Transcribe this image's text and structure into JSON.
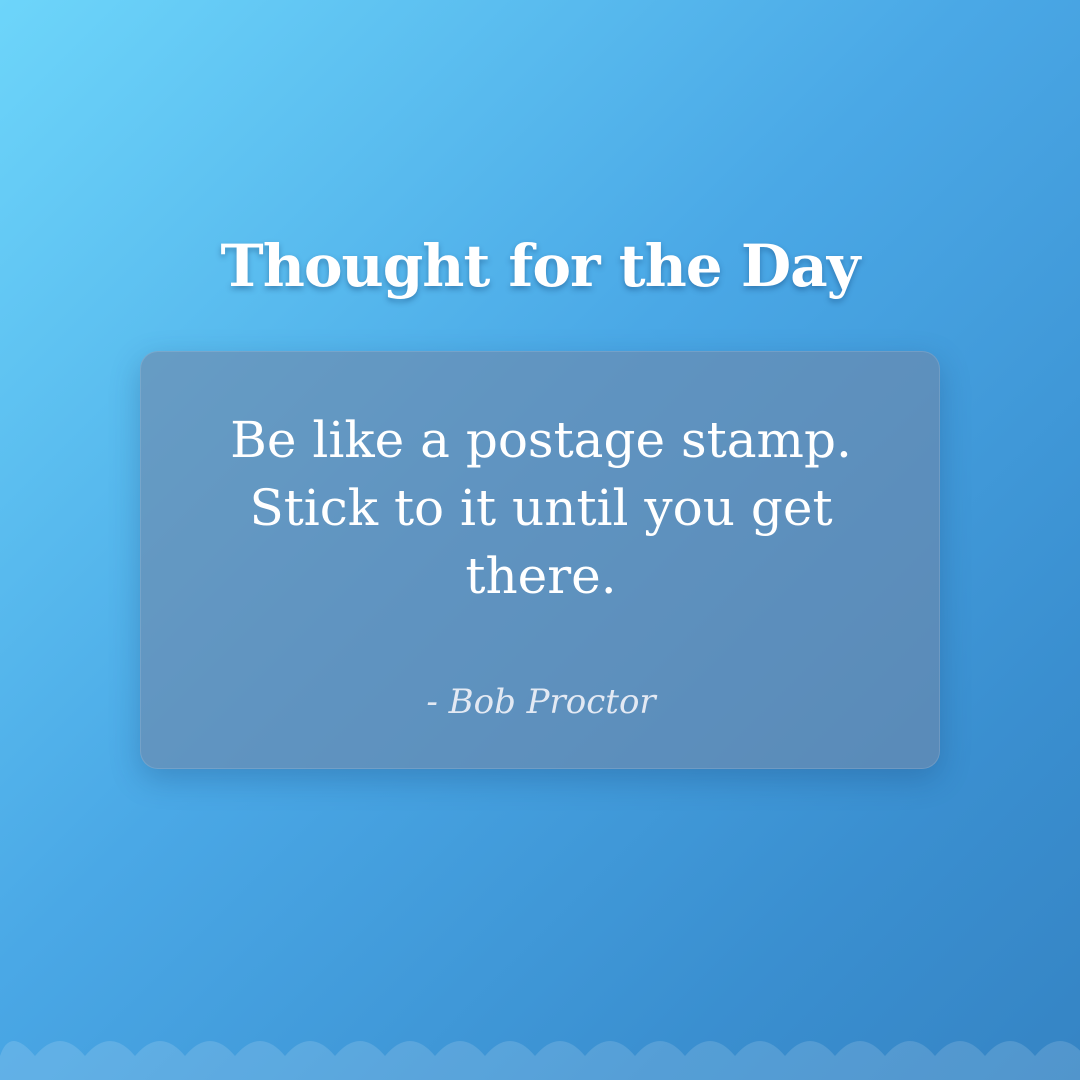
{
  "header": {
    "title": "Thought for the Day"
  },
  "quote": {
    "text": "Be like a postage stamp. Stick to it until you get there.",
    "author": "- Bob Proctor"
  },
  "colors": {
    "background_start": "#6dd5fa",
    "background_end": "#3584c4",
    "card": "#6e87aa",
    "text": "#ffffff",
    "author_text": "#e3e9f3"
  }
}
